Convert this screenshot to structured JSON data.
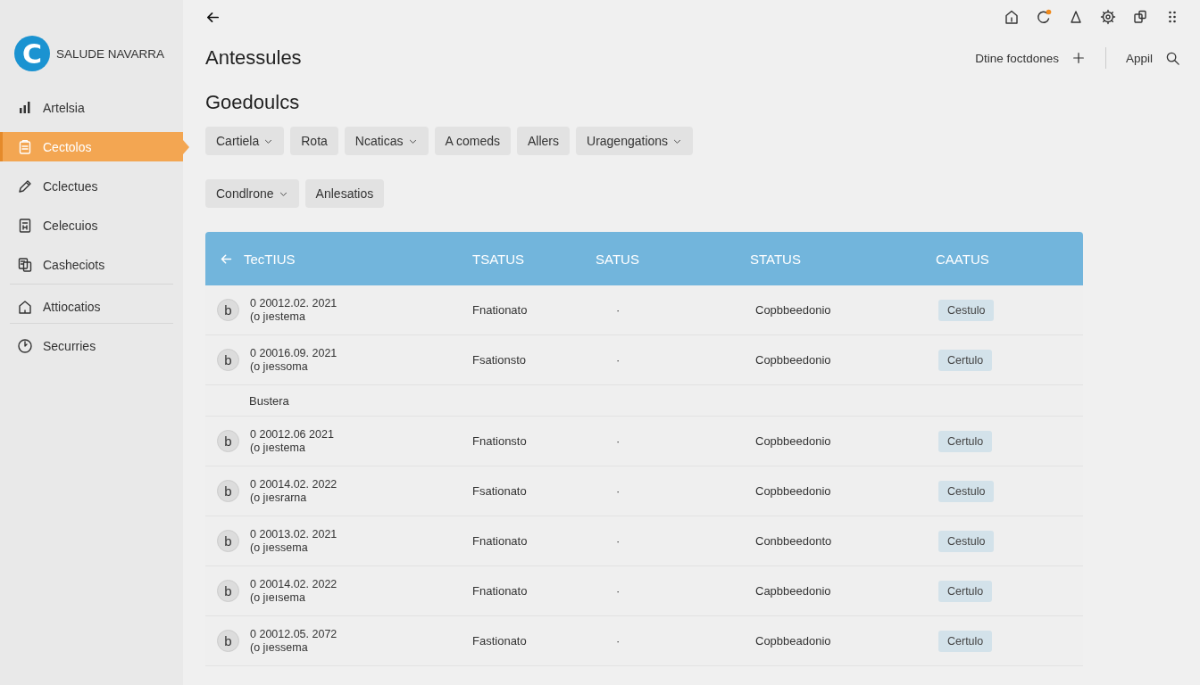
{
  "brand": {
    "logo": "C",
    "name": "SALUDE NAVARRA"
  },
  "sidebar": {
    "items": [
      {
        "label": "Artelsia",
        "selected": false,
        "divider_before": false
      },
      {
        "label": "Cectolos",
        "selected": true,
        "divider_before": false
      },
      {
        "label": "Cclectues",
        "selected": false,
        "divider_before": false
      },
      {
        "label": "Celecuios",
        "selected": false,
        "divider_before": false
      },
      {
        "label": "Casheciots",
        "selected": false,
        "divider_before": false
      },
      {
        "label": "Attiocatios",
        "selected": false,
        "divider_before": true
      },
      {
        "label": "Securries",
        "selected": false,
        "divider_before": true
      }
    ]
  },
  "header": {
    "title": "Antessules",
    "action_label": "Dtine foctdones",
    "account": "Appil"
  },
  "section": {
    "title": "Goedoulcs"
  },
  "filter_rows": [
    [
      {
        "label": "Cartiela",
        "dropdown": true
      },
      {
        "label": "Rota",
        "dropdown": false
      },
      {
        "label": "Ncaticas",
        "dropdown": true
      },
      {
        "label": "A comeds",
        "dropdown": false
      },
      {
        "label": "Allers",
        "dropdown": false
      },
      {
        "label": "Uragengations",
        "dropdown": true
      }
    ],
    [
      {
        "label": "Condlrone",
        "dropdown": true
      },
      {
        "label": "Anlesatios",
        "dropdown": false
      }
    ]
  ],
  "table": {
    "columns": [
      "TecTIUS",
      "TSATUS",
      "SATUS",
      "STATUS",
      "CAATUS"
    ],
    "rows": [
      {
        "kind": "record",
        "avatar": "b",
        "date": "0 20012.02. 2021",
        "sub": "(o jıestema",
        "status": "Fnationato",
        "mark": "·",
        "detail": "Copbbeedonio",
        "tag": "Cestulo"
      },
      {
        "kind": "record",
        "avatar": "b",
        "date": "0 20016.09. 2021",
        "sub": "(o jıessoma",
        "status": "Fsationsto",
        "mark": "·",
        "detail": "Copbbeedonio",
        "tag": "Certulo"
      },
      {
        "kind": "group",
        "label": "Bustera"
      },
      {
        "kind": "record",
        "avatar": "b",
        "date": "0 20012.06 2021",
        "sub": "(o jıestema",
        "status": "Fnationsto",
        "mark": "·",
        "detail": "Copbbeedonio",
        "tag": "Certulo"
      },
      {
        "kind": "record",
        "avatar": "b",
        "date": "0 20014.02. 2022",
        "sub": "(o jıesrarna",
        "status": "Fsationato",
        "mark": "·",
        "detail": "Copbbeedonio",
        "tag": "Cestulo"
      },
      {
        "kind": "record",
        "avatar": "b",
        "date": "0 20013.02. 2021",
        "sub": "(o jıessema",
        "status": "Fnationato",
        "mark": "·",
        "detail": "Conbbeedonto",
        "tag": "Cestulo"
      },
      {
        "kind": "record",
        "avatar": "b",
        "date": "0 20014.02. 2022",
        "sub": "(o jıeısema",
        "status": "Fnationato",
        "mark": "·",
        "detail": "Capbbeedonio",
        "tag": "Certulo"
      },
      {
        "kind": "record",
        "avatar": "b",
        "date": "0 20012.05. 2072",
        "sub": "(o jıessema",
        "status": "Fastionato",
        "mark": "·",
        "detail": "Copbbeadonio",
        "tag": "Certulo"
      }
    ]
  }
}
